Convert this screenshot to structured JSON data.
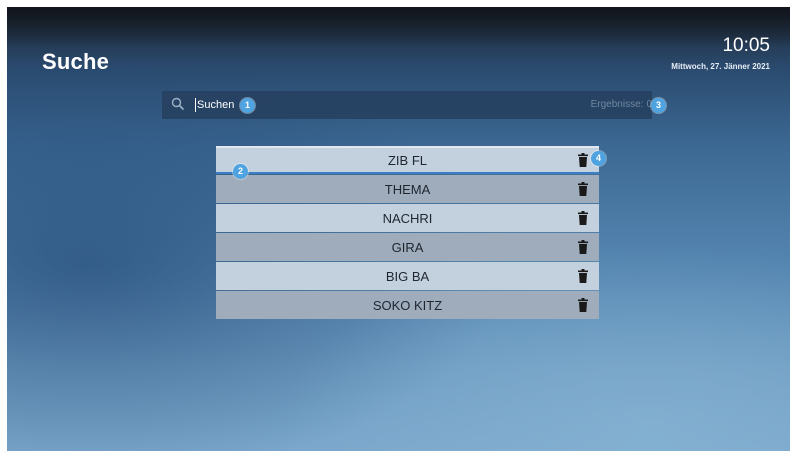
{
  "header": {
    "title": "Suche",
    "time": "10:05",
    "date": "Mittwoch, 27. Jänner 2021"
  },
  "search": {
    "placeholder": "Suchen",
    "results_label": "Ergebnisse:",
    "results_count": "0"
  },
  "history": [
    {
      "label": "ZIB FL",
      "delete_icon": "trash-icon"
    },
    {
      "label": "THEMA",
      "delete_icon": "trash-icon"
    },
    {
      "label": "NACHRI",
      "delete_icon": "trash-icon"
    },
    {
      "label": "GIRA",
      "delete_icon": "trash-icon"
    },
    {
      "label": "BIG BA",
      "delete_icon": "trash-icon"
    },
    {
      "label": "SOKO KITZ",
      "delete_icon": "trash-icon"
    }
  ],
  "callouts": [
    "1",
    "2",
    "3",
    "4"
  ],
  "colors": {
    "badge": "#4fa3e0",
    "row_light": "#c3d1df",
    "row_dark": "#9eacbb",
    "search_bar": "#26405f"
  }
}
